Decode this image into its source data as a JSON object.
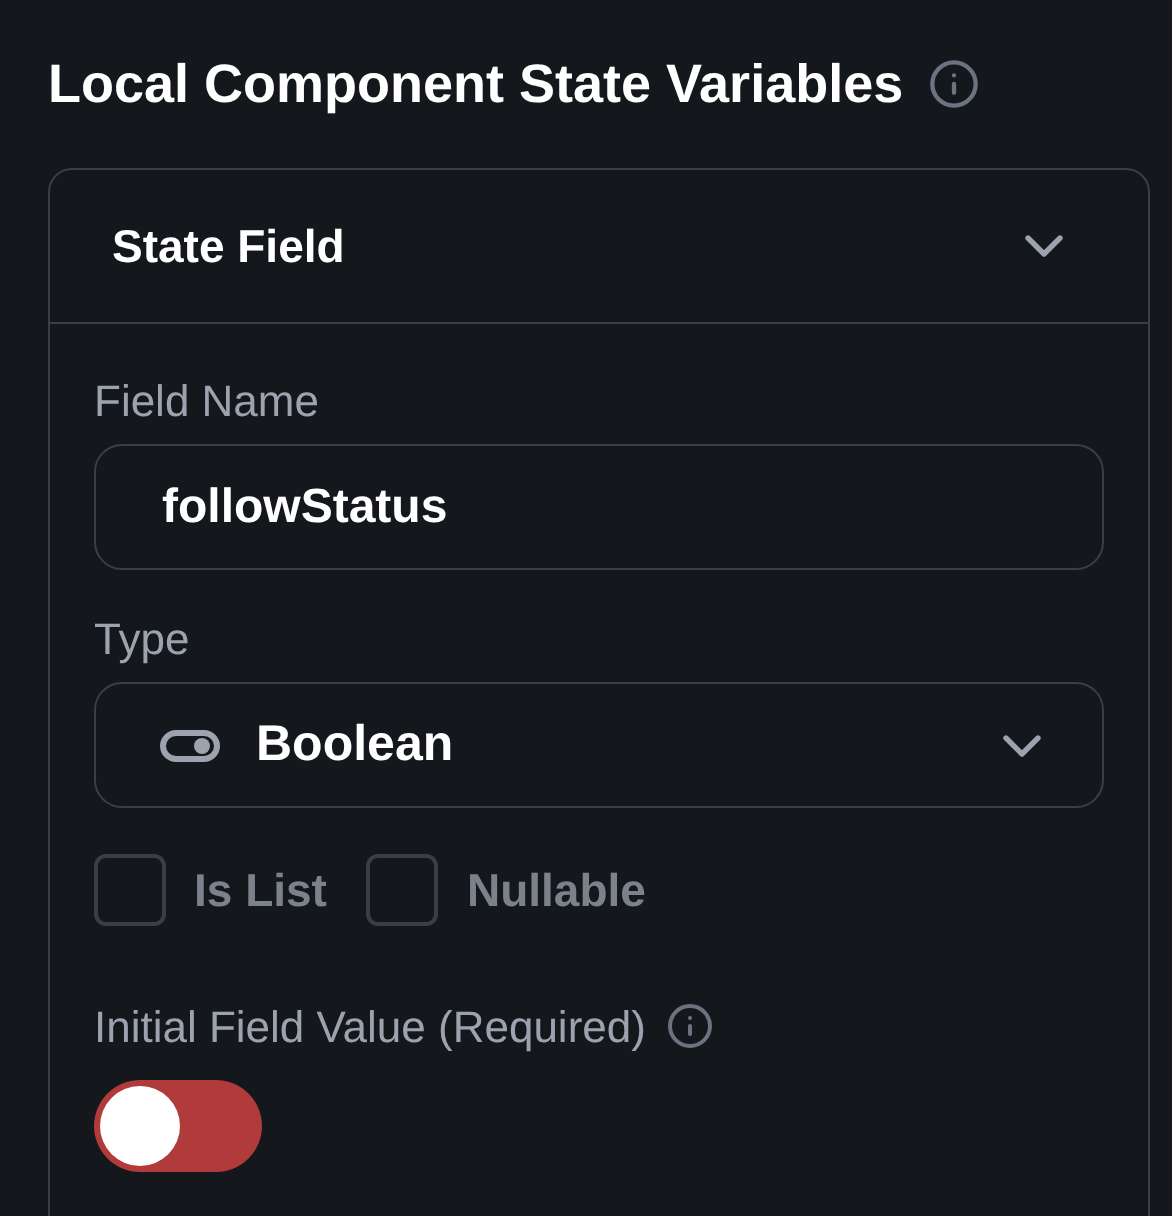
{
  "title": "Local Component State Variables",
  "card": {
    "header": "State Field",
    "expanded": true,
    "field_name": {
      "label": "Field Name",
      "value": "followStatus"
    },
    "type": {
      "label": "Type",
      "value": "Boolean"
    },
    "options": [
      {
        "label": "Is List",
        "checked": false
      },
      {
        "label": "Nullable",
        "checked": false
      }
    ],
    "initial_value": {
      "label": "Initial Field Value (Required)",
      "on": false
    }
  }
}
